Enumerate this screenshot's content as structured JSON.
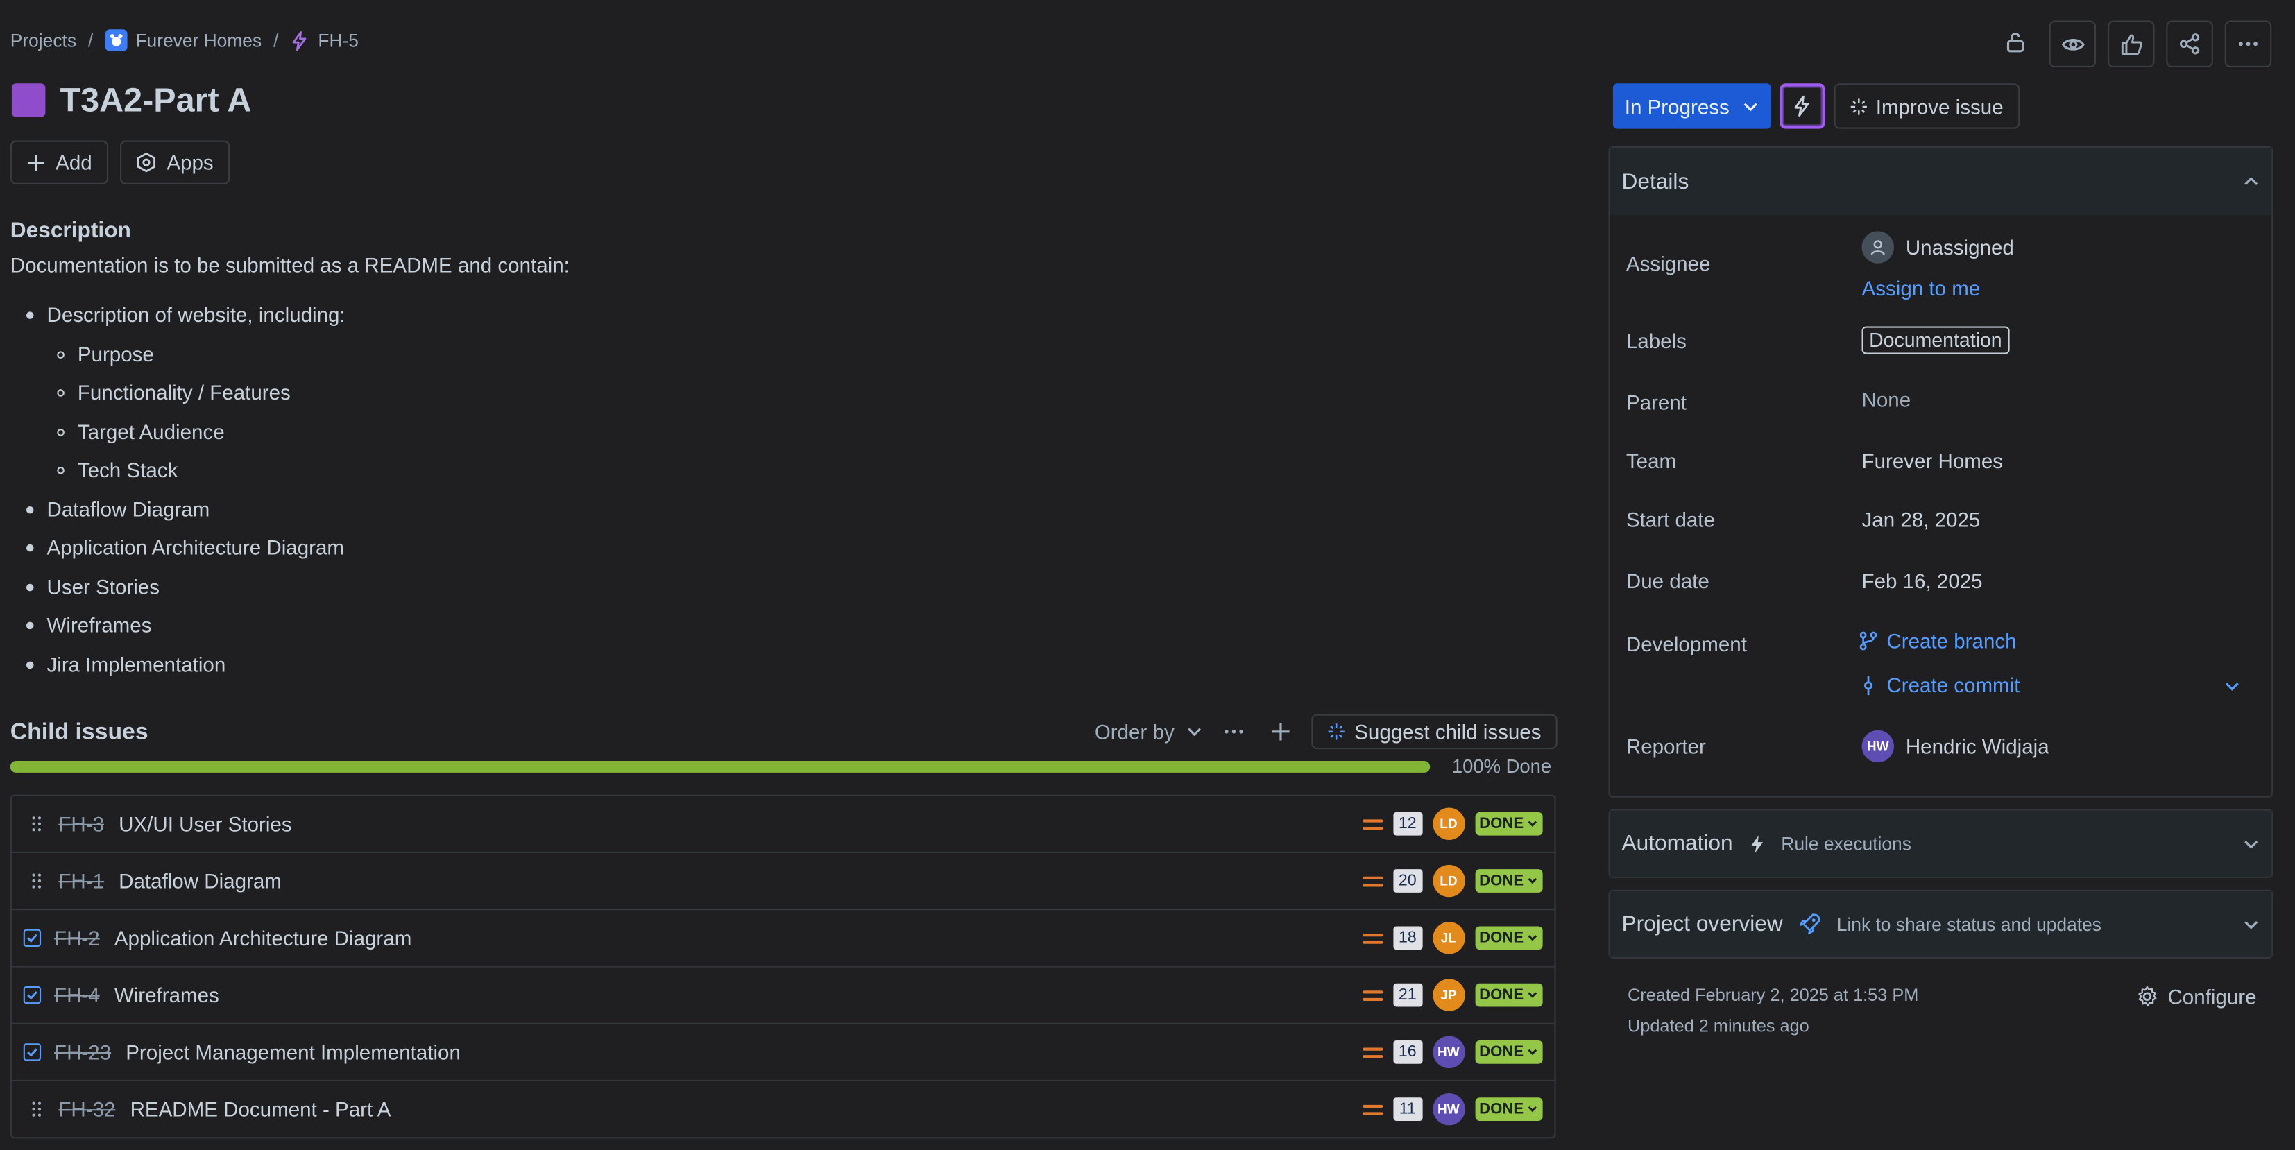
{
  "breadcrumb": {
    "projects": "Projects",
    "project": "Furever Homes",
    "issue": "FH-5",
    "separator": "/"
  },
  "issue": {
    "title": "T3A2-Part A",
    "type_color": "#8f4dcc",
    "add_label": "Add",
    "apps_label": "Apps"
  },
  "description": {
    "heading": "Description",
    "intro": "Documentation is to be submitted as a README and contain:",
    "item1": "Description of website, including:",
    "sub1": "Purpose",
    "sub2": "Functionality / Features",
    "sub3": "Target Audience",
    "sub4": "Tech Stack",
    "item2": "Dataflow Diagram",
    "item3": "Application Architecture Diagram",
    "item4": "User Stories",
    "item5": "Wireframes",
    "item6": "Jira Implementation"
  },
  "child": {
    "heading": "Child issues",
    "order_by": "Order by",
    "suggest": "Suggest child issues",
    "progress_label": "100% Done",
    "progress": 1.0,
    "rows": [
      {
        "key": "FH-3",
        "summary": "UX/UI User Stories",
        "estimate": "12",
        "avatar": "LD",
        "avatar_color": "#e38a1c",
        "status": "DONE",
        "checkbox": false
      },
      {
        "key": "FH-1",
        "summary": "Dataflow Diagram",
        "estimate": "20",
        "avatar": "LD",
        "avatar_color": "#e38a1c",
        "status": "DONE",
        "checkbox": false
      },
      {
        "key": "FH-2",
        "summary": "Application Architecture Diagram",
        "estimate": "18",
        "avatar": "JL",
        "avatar_color": "#e38a1c",
        "status": "DONE",
        "checkbox": true
      },
      {
        "key": "FH-4",
        "summary": "Wireframes",
        "estimate": "21",
        "avatar": "JP",
        "avatar_color": "#e38a1c",
        "status": "DONE",
        "checkbox": true
      },
      {
        "key": "FH-23",
        "summary": "Project Management Implementation",
        "estimate": "16",
        "avatar": "HW",
        "avatar_color": "#5e4db2",
        "status": "DONE",
        "checkbox": true
      },
      {
        "key": "FH-32",
        "summary": "README Document - Part A",
        "estimate": "11",
        "avatar": "HW",
        "avatar_color": "#5e4db2",
        "status": "DONE",
        "checkbox": false
      }
    ]
  },
  "status_bar": {
    "status": "In Progress",
    "improve": "Improve issue"
  },
  "details": {
    "heading": "Details",
    "assignee_label": "Assignee",
    "assignee": "Unassigned",
    "assign_to_me": "Assign to me",
    "labels_label": "Labels",
    "label_value": "Documentation",
    "parent_label": "Parent",
    "parent": "None",
    "team_label": "Team",
    "team": "Furever Homes",
    "start_label": "Start date",
    "start": "Jan 28, 2025",
    "due_label": "Due date",
    "due": "Feb 16, 2025",
    "dev_label": "Development",
    "create_branch": "Create branch",
    "create_commit": "Create commit",
    "reporter_label": "Reporter",
    "reporter_initials": "HW",
    "reporter": "Hendric Widjaja"
  },
  "automation": {
    "heading": "Automation",
    "sub": "Rule executions"
  },
  "overview": {
    "heading": "Project overview",
    "sub": "Link to share status and updates"
  },
  "meta": {
    "created": "Created February 2, 2025 at 1:53 PM",
    "updated": "Updated 2 minutes ago",
    "configure": "Configure"
  }
}
